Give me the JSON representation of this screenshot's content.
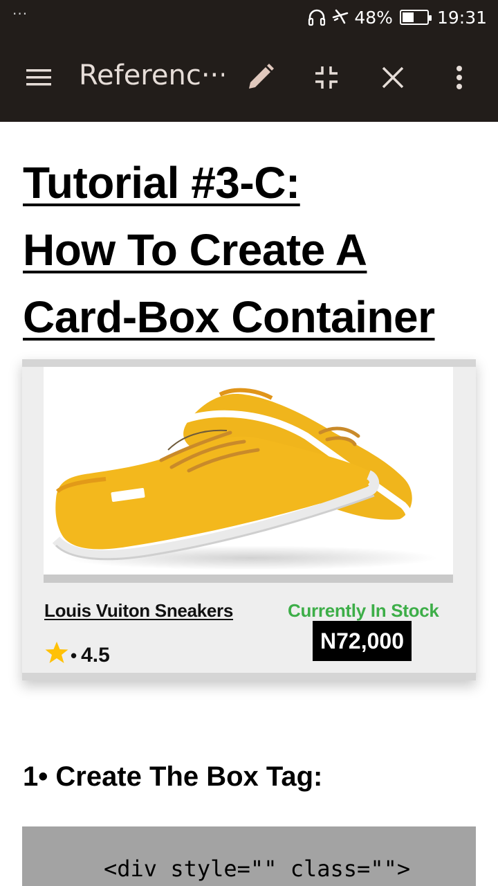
{
  "status_bar": {
    "overflow_indicator": "···",
    "battery_text": "48%",
    "battery_level": 0.48,
    "time": "19:31",
    "icons": [
      "headphones-icon",
      "airplane-mode-icon",
      "battery-icon"
    ]
  },
  "app_bar": {
    "title": "Referenc···",
    "icons": [
      "menu-icon",
      "edit-pencil-icon",
      "collapse-icon",
      "close-icon",
      "more-vert-icon"
    ]
  },
  "article": {
    "title_lines": [
      "Tutorial #3-C:",
      "How To Create A",
      "Card-Box Container"
    ]
  },
  "card": {
    "image_icon": "yellow-sneakers-image",
    "product_name": "Louis Vuiton Sneakers",
    "stock_status": "Currently In Stock",
    "price": "N72,000",
    "rating_separator": "•",
    "rating_value": "4.5",
    "rating_icon": "star-icon"
  },
  "section": {
    "heading": "1• Create The Box Tag:",
    "code": "<div style=\"\" class=\"\">"
  },
  "colors": {
    "app_bar_bg": "#221d1a",
    "stock_green": "#3dae48",
    "price_bg": "#000000",
    "star_yellow": "#ffc107",
    "code_bg": "#a3a3a3"
  }
}
